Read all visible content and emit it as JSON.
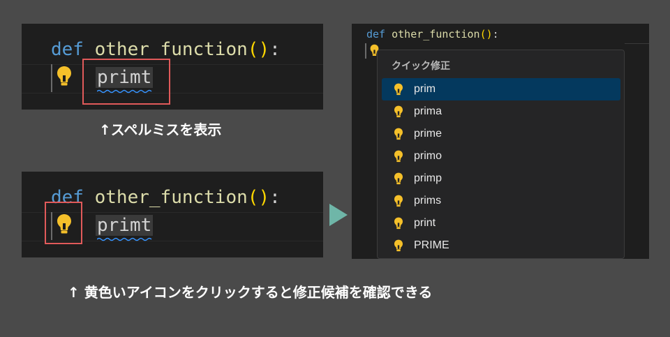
{
  "code": {
    "keyword": "def",
    "func_name": "other_function",
    "open_paren": "(",
    "close_paren": ")",
    "colon": ":",
    "misspelled": "primt"
  },
  "captions": {
    "top": "↑スペルミスを表示",
    "bottom": "↑ 黄色いアイコンをクリックすると修正候補を確認できる"
  },
  "quick_fix": {
    "title": "クイック修正",
    "items": [
      {
        "label": "prim",
        "active": true
      },
      {
        "label": "prima"
      },
      {
        "label": "prime"
      },
      {
        "label": "primo"
      },
      {
        "label": "primp"
      },
      {
        "label": "prims"
      },
      {
        "label": "print"
      },
      {
        "label": "PRIME"
      }
    ]
  },
  "colors": {
    "keyword": "#569cd6",
    "function": "#dcdcaa",
    "paren": "#ffd700",
    "bulb": "#f5c02a",
    "selected_item": "#04395e",
    "highlight_box": "#e15a5a",
    "arrow": "#6fb6a8"
  }
}
